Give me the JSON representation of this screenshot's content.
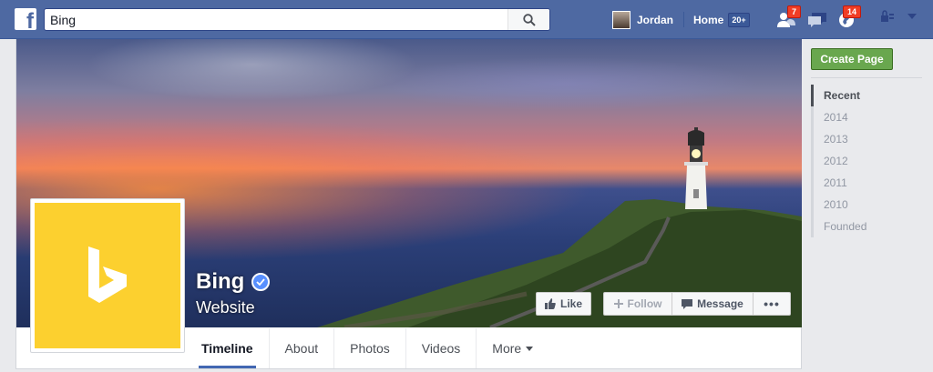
{
  "topbar": {
    "logo_letter": "f",
    "search_value": "Bing",
    "user_name": "Jordan",
    "home_label": "Home",
    "home_count": "20+",
    "friend_requests_count": "7",
    "notifications_count": "14"
  },
  "page": {
    "name": "Bing",
    "category": "Website",
    "actions": {
      "like": "Like",
      "follow": "Follow",
      "message": "Message",
      "more": "•••"
    },
    "tabs": [
      "Timeline",
      "About",
      "Photos",
      "Videos",
      "More"
    ],
    "active_tab": "Timeline"
  },
  "sidebar": {
    "create_page": "Create Page",
    "years": [
      "Recent",
      "2014",
      "2013",
      "2012",
      "2011",
      "2010",
      "Founded"
    ],
    "active_year": "Recent"
  },
  "colors": {
    "topbar": "#4e69a2",
    "brand_yellow": "#fcd02f",
    "create_green": "#69a74e",
    "verified_blue": "#5890ff"
  }
}
